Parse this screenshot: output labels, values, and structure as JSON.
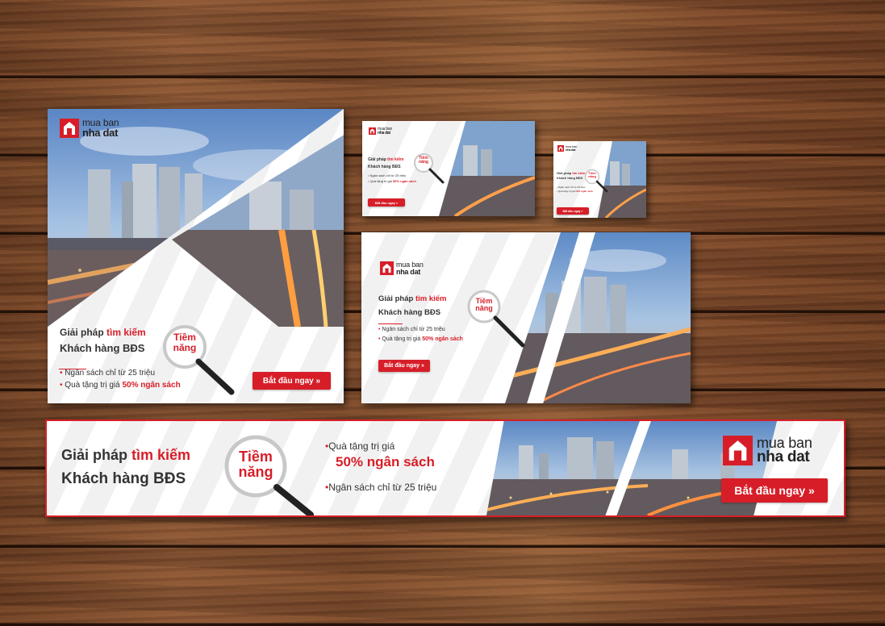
{
  "brand": {
    "logo_top": "mua ban",
    "logo_bottom": "nha dat"
  },
  "ad": {
    "headline_prefix": "Giải pháp",
    "headline_highlight": "tìm kiếm",
    "headline_line2": "Khách hàng BĐS",
    "magnifier_line1": "Tiềm",
    "magnifier_line2": "năng",
    "bullet_budget": "Ngân sách chỉ từ 25 triệu",
    "bullet_gift_prefix": "Quà tặng trị giá",
    "bullet_gift_highlight": "50% ngân sách",
    "cta_label": "Bắt đầu ngay"
  },
  "colors": {
    "brand_red": "#d71e28",
    "wood": "#7a4a2c"
  },
  "icons": [
    "house-logo-icon",
    "magnifier-icon",
    "double-chevron-right-icon"
  ]
}
